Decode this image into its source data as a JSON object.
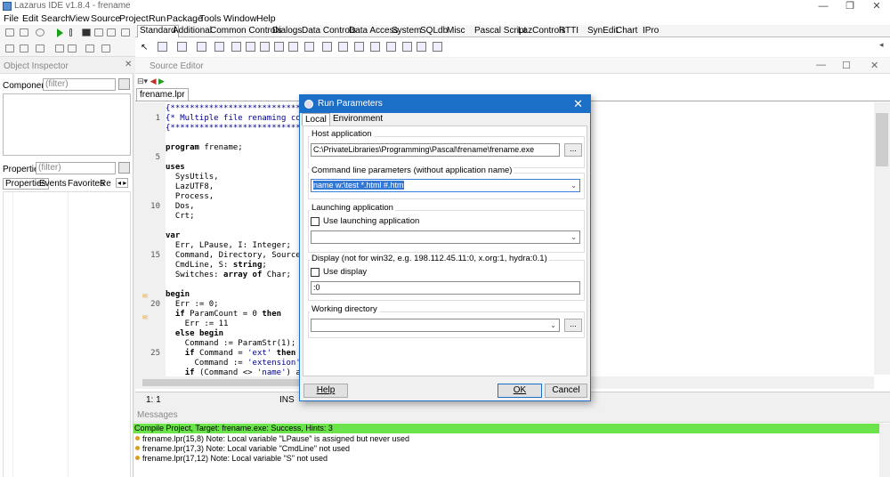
{
  "window": {
    "title": "Lazarus IDE v1.8.4 - frename"
  },
  "menu": [
    "File",
    "Edit",
    "Search",
    "View",
    "Source",
    "Project",
    "Run",
    "Package",
    "Tools",
    "Window",
    "Help"
  ],
  "palette_tabs": [
    "Standard",
    "Additional",
    "Common Controls",
    "Dialogs",
    "Data Controls",
    "Data Access",
    "System",
    "SQLdb",
    "Misc",
    "Pascal Script",
    "LazControls",
    "RTTI",
    "SynEdit",
    "Chart",
    "IPro"
  ],
  "object_inspector": {
    "title": "Object Inspector",
    "components_label": "Components",
    "components_filter": "(filter)",
    "properties_label": "Properties",
    "properties_filter": "(filter)",
    "tabs": [
      "Properties",
      "Events",
      "Favorites",
      "Re"
    ]
  },
  "source_editor": {
    "title": "Source Editor",
    "file_tab": "frename.lpr",
    "status": {
      "pos": "1:  1",
      "mode": "INS"
    },
    "line_numbers": [
      {
        "line": 2,
        "text": "1"
      },
      {
        "line": 6,
        "text": "5"
      },
      {
        "line": 11,
        "text": "10"
      },
      {
        "line": 16,
        "text": "15"
      },
      {
        "line": 21,
        "text": "20"
      },
      {
        "line": 26,
        "text": "25"
      }
    ]
  },
  "code_lines": [
    "{*******************************",
    "{* Multiple file renaming con",
    "{*******************************",
    "",
    "program frename;",
    "",
    "uses",
    "  SysUtils,",
    "  LazUTF8,",
    "  Process,",
    "  Dos,",
    "  Crt;",
    "",
    "var",
    "  Err, LPause, I: Integer;",
    "  Command, Directory, Source,",
    "  CmdLine, S: string;",
    "  Switches: array of Char;",
    "",
    "begin",
    "  Err := 0;",
    "  if ParamCount = 0 then",
    "    Err := 11",
    "  else begin",
    "    Command := ParamStr(1);",
    "    if Command = 'ext' then",
    "      Command := 'extension';",
    "    if (Command <> 'name') ar"
  ],
  "messages": {
    "title": "Messages",
    "success": "Compile Project, Target: frename.exe: Success, Hints: 3",
    "notes": [
      "frename.lpr(15,8) Note: Local variable \"LPause\" is assigned but never used",
      "frename.lpr(17,3) Note: Local variable \"CmdLine\" not used",
      "frename.lpr(17,12) Note: Local variable \"S\" not used"
    ]
  },
  "dialog": {
    "title": "Run Parameters",
    "tabs": [
      "Local",
      "Environment"
    ],
    "host_label": "Host application",
    "host_value": "C:\\PrivateLibraries\\Programming\\Pascal\\frename\\frename.exe",
    "cmd_label": "Command line parameters (without application name)",
    "cmd_value": "name w:\\test *.html #.htm",
    "launch_label": "Launching application",
    "use_launch_label": "Use launching application",
    "display_label": "Display (not for win32, e.g. 198.112.45.11:0, x.org:1, hydra:0.1)",
    "use_display_label": "Use display",
    "display_value": ":0",
    "workdir_label": "Working directory",
    "help_label": "Help",
    "ok_label": "OK",
    "cancel_label": "Cancel",
    "browse_label": "..."
  },
  "colors": {
    "accent": "#1c6fc6",
    "success_bar": "#6be34a"
  }
}
